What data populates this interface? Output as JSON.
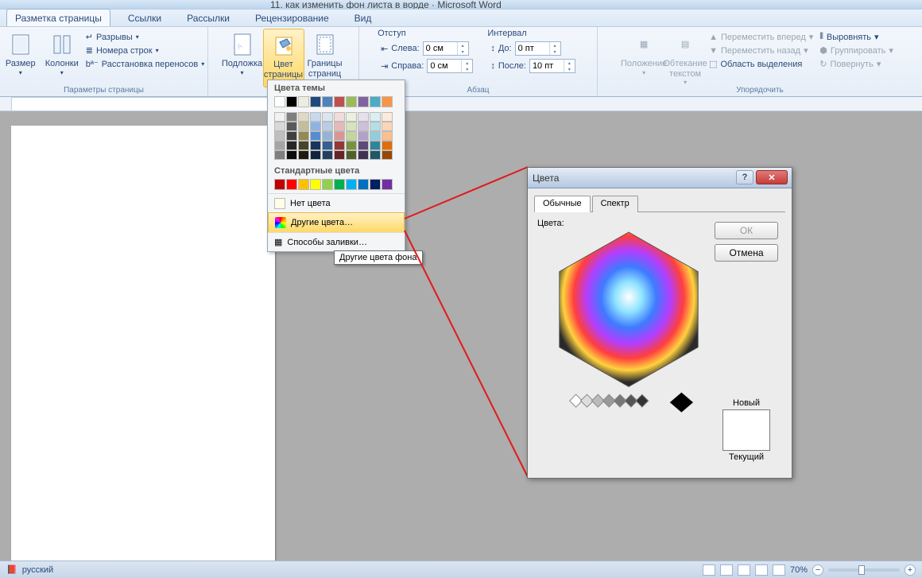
{
  "title": "11. как изменить фон листа в ворде · Microsoft Word",
  "tabs": [
    "Разметка страницы",
    "Ссылки",
    "Рассылки",
    "Рецензирование",
    "Вид"
  ],
  "ribbon": {
    "page_setup_label": "Параметры страницы",
    "size": "Размер",
    "columns": "Колонки",
    "breaks": "Разрывы",
    "line_numbers": "Номера строк",
    "hyphenation": "Расстановка переносов",
    "watermark": "Подложка",
    "page_color": "Цвет\nстраницы",
    "borders": "Границы\nстраниц",
    "indent_header": "Отступ",
    "indent_left_label": "Слева:",
    "indent_right_label": "Справа:",
    "indent_left": "0 см",
    "indent_right": "0 см",
    "spacing_header": "Интервал",
    "spacing_before_label": "До:",
    "spacing_after_label": "После:",
    "spacing_before": "0 пт",
    "spacing_after": "10 пт",
    "paragraph_label": "Абзац",
    "position": "Положение",
    "wrap": "Обтекание\nтекстом",
    "bring_forward": "Переместить вперед",
    "send_backward": "Переместить назад",
    "selection_pane": "Область выделения",
    "align": "Выровнять",
    "group": "Группировать",
    "rotate": "Повернуть",
    "arrange_label": "Упорядочить"
  },
  "dropdown": {
    "theme_colors": "Цвета темы",
    "standard_colors": "Стандартные цвета",
    "no_color": "Нет цвета",
    "more_colors": "Другие цвета…",
    "fill_effects": "Способы заливки…",
    "tooltip": "Другие цвета фона",
    "theme_row1": [
      "#ffffff",
      "#000000",
      "#eeece1",
      "#1f497d",
      "#4f81bd",
      "#c0504d",
      "#9bbb59",
      "#8064a2",
      "#4bacc6",
      "#f79646"
    ],
    "theme_shades": [
      [
        "#f2f2f2",
        "#7f7f7f",
        "#ddd9c3",
        "#c6d9f0",
        "#dbe5f1",
        "#f2dcdb",
        "#ebf1dd",
        "#e5e0ec",
        "#dbeef3",
        "#fdeada"
      ],
      [
        "#d8d8d8",
        "#595959",
        "#c4bd97",
        "#8db3e2",
        "#b8cce4",
        "#e5b9b7",
        "#d7e3bc",
        "#ccc1d9",
        "#b7dde8",
        "#fbd5b5"
      ],
      [
        "#bfbfbf",
        "#3f3f3f",
        "#938953",
        "#548dd4",
        "#95b3d7",
        "#d99694",
        "#c3d69b",
        "#b2a2c7",
        "#92cddc",
        "#fac08f"
      ],
      [
        "#a5a5a5",
        "#262626",
        "#494429",
        "#17365d",
        "#366092",
        "#953734",
        "#76923c",
        "#5f497a",
        "#31859b",
        "#e36c09"
      ],
      [
        "#7f7f7f",
        "#0c0c0c",
        "#1d1b10",
        "#0f243e",
        "#244061",
        "#632423",
        "#4f6128",
        "#3f3151",
        "#205867",
        "#974806"
      ]
    ],
    "standard": [
      "#c00000",
      "#ff0000",
      "#ffc000",
      "#ffff00",
      "#92d050",
      "#00b050",
      "#00b0f0",
      "#0070c0",
      "#002060",
      "#7030a0"
    ]
  },
  "dialog": {
    "title": "Цвета",
    "tab_standard": "Обычные",
    "tab_custom": "Спектр",
    "colors_label": "Цвета:",
    "ok": "ОК",
    "cancel": "Отмена",
    "new": "Новый",
    "current": "Текущий"
  },
  "status": {
    "language": "русский",
    "zoom": "70%"
  }
}
